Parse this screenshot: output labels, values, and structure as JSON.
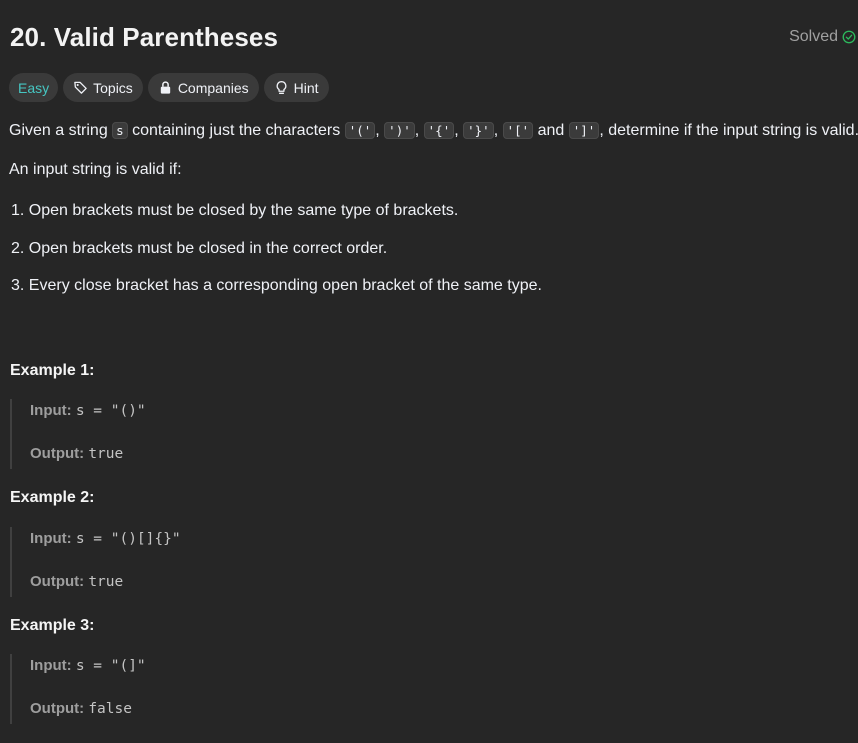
{
  "problem": {
    "title": "20. Valid Parentheses",
    "status": "Solved",
    "difficulty": "Easy",
    "tags": [
      "Topics",
      "Companies",
      "Hint"
    ]
  },
  "description": {
    "lead": "Given a string ",
    "var": "s",
    "mid": " containing just the characters ",
    "chars": [
      "'('",
      "')'",
      "'{'",
      "'}'",
      "'['",
      "']'"
    ],
    "sep": ", ",
    "and": " and ",
    "tail": ", determine if the input string is valid.",
    "valid_if": "An input string is valid if:",
    "rules": [
      "1. Open brackets must be closed by the same type of brackets.",
      "2. Open brackets must be closed in the correct order.",
      "3. Every close bracket has a corresponding open bracket of the same type."
    ]
  },
  "examples": [
    {
      "title": "Example 1:",
      "input_label": "Input:",
      "input": "s = \"()\"",
      "output_label": "Output:",
      "output": "true"
    },
    {
      "title": "Example 2:",
      "input_label": "Input:",
      "input": "s = \"()[]{}\"",
      "output_label": "Output:",
      "output": "true"
    },
    {
      "title": "Example 3:",
      "input_label": "Input:",
      "input": "s = \"(]\"",
      "output_label": "Output:",
      "output": "false"
    }
  ],
  "colors": {
    "easy": "#46c6c2",
    "solved_check": "#2cbb5d",
    "background": "#262626"
  }
}
